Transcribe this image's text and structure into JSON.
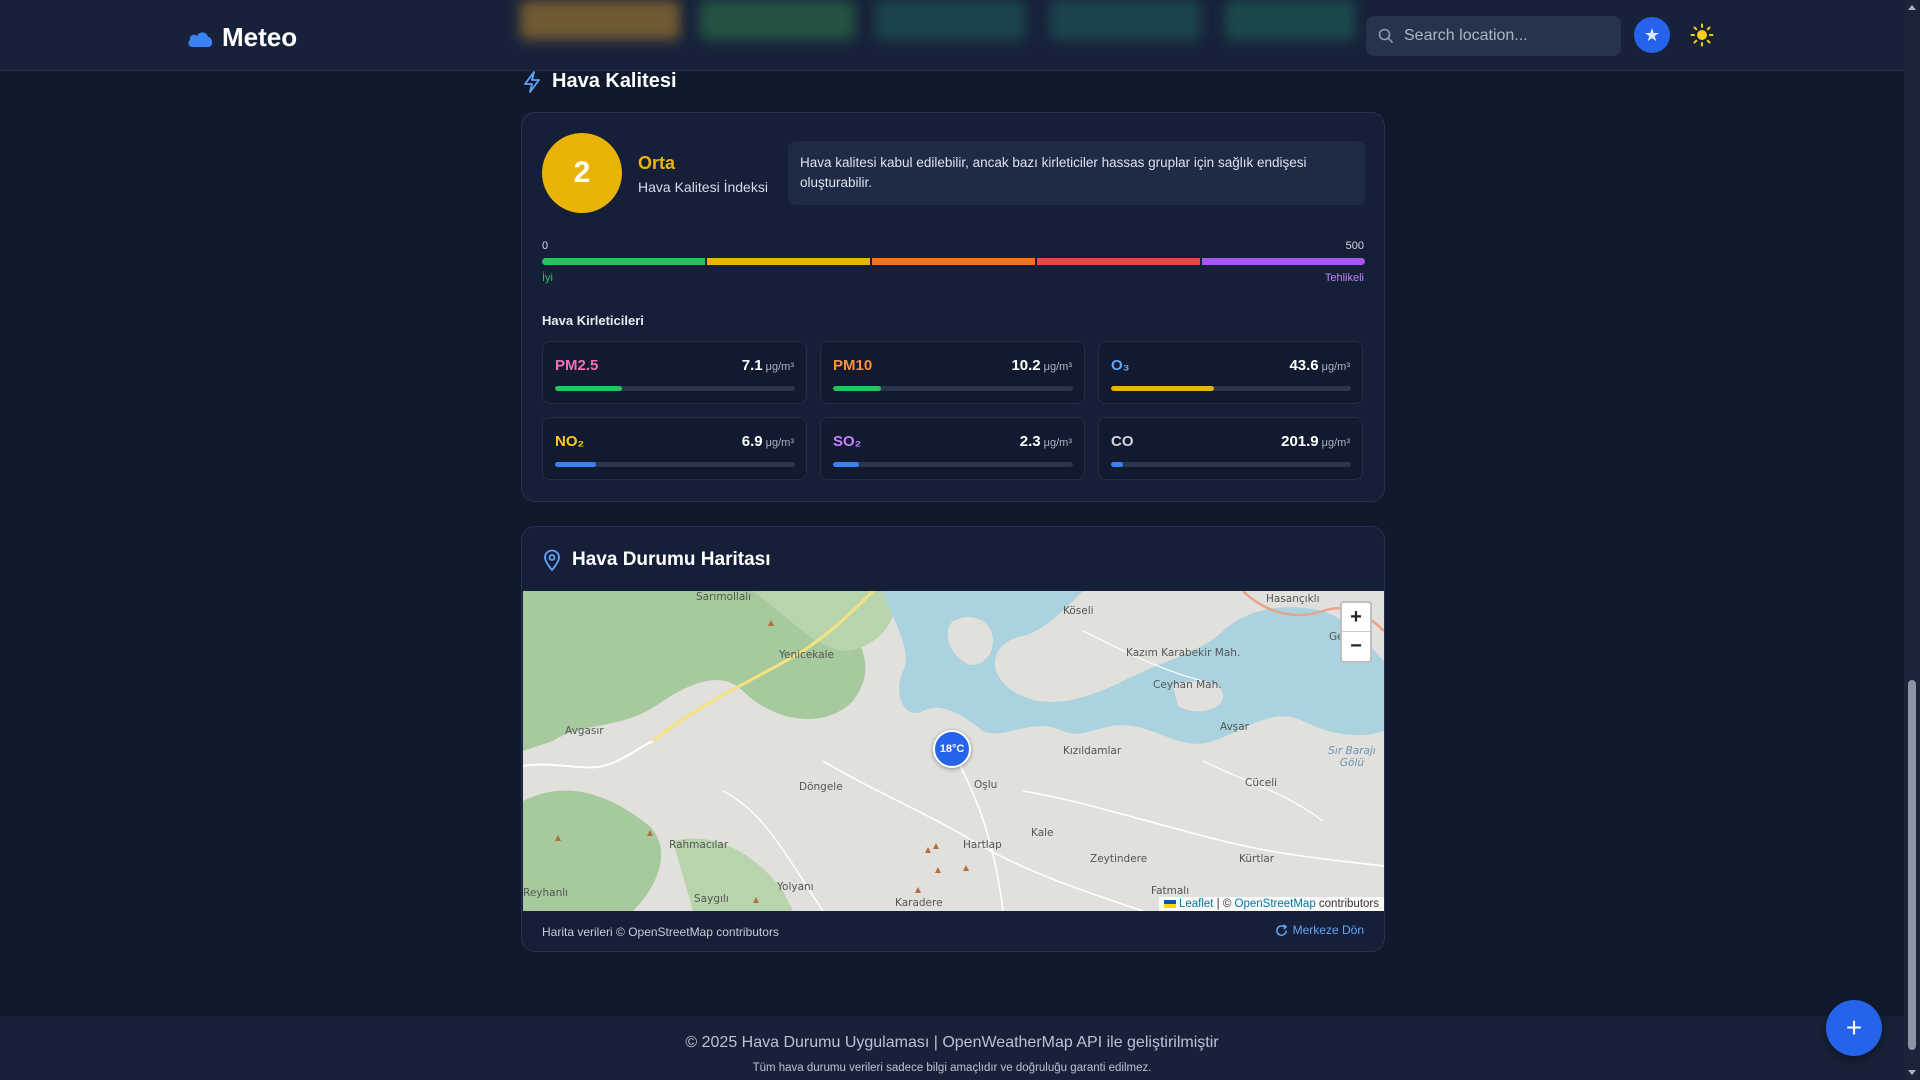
{
  "header": {
    "app_name": "Meteo",
    "search_placeholder": "Search location...",
    "favorites_icon": "star-icon",
    "theme_icon": "sun-icon"
  },
  "air_quality": {
    "section_title": "Hava Kalitesi",
    "aqi_value": "2",
    "aqi_level": "Orta",
    "aqi_label": "Hava Kalitesi İndeksi",
    "description": "Hava kalitesi kabul edilebilir, ancak bazı kirleticiler hassas gruplar için sağlık endişesi oluşturabilir.",
    "scale_min": "0",
    "scale_max": "500",
    "scale_low_label": "İyi",
    "scale_high_label": "Tehlikeli",
    "scale_colors": [
      "#22c55e",
      "#eab308",
      "#f97316",
      "#ef4444",
      "#a855f7"
    ],
    "pollutants_title": "Hava Kirleticileri",
    "pollutants": [
      {
        "name": "PM2.5",
        "value": "7.1",
        "unit": "μg/m³",
        "color": "#f472b6",
        "bar_color": "#22c55e",
        "level_pct": 28
      },
      {
        "name": "PM10",
        "value": "10.2",
        "unit": "μg/m³",
        "color": "#fb923c",
        "bar_color": "#22c55e",
        "level_pct": 20
      },
      {
        "name": "O₃",
        "value": "43.6",
        "unit": "μg/m³",
        "color": "#60a5fa",
        "bar_color": "#eab308",
        "level_pct": 43
      },
      {
        "name": "NO₂",
        "value": "6.9",
        "unit": "μg/m³",
        "color": "#facc15",
        "bar_color": "#3b82f6",
        "level_pct": 17
      },
      {
        "name": "SO₂",
        "value": "2.3",
        "unit": "μg/m³",
        "color": "#c084fc",
        "bar_color": "#3b82f6",
        "level_pct": 11
      },
      {
        "name": "CO",
        "value": "201.9",
        "unit": "μg/m³",
        "color": "#d1d5db",
        "bar_color": "#3b82f6",
        "level_pct": 5
      }
    ]
  },
  "map": {
    "section_title": "Hava Durumu Haritası",
    "marker_temp": "18°C",
    "zoom_in": "+",
    "zoom_out": "−",
    "attribution_leaflet": "Leaflet",
    "attribution_sep": " | © ",
    "attribution_osm": "OpenStreetMap",
    "attribution_tail": " contributors",
    "footer_left": "Harita verileri © OpenStreetMap contributors",
    "center_button": "Merkeze Dön",
    "places": [
      "Sarımollalı",
      "Köseli",
      "Hasançıklı",
      "Yenicekale",
      "Kazım Karabekir Mah.",
      "Ceyhan Mah.",
      "Avgasır",
      "Avşar",
      "Kızıldamlar",
      "Sır Barajı Gölü",
      "Döngele",
      "Oşlu",
      "Cüceli",
      "Rahmacılar",
      "Hartlap",
      "Kale",
      "Zeytindere",
      "Kürtlar",
      "Yolyanı",
      "Saygılı",
      "Karadere",
      "Fatmalı",
      "Reyhanlı",
      "Ge"
    ]
  },
  "footer": {
    "main": "© 2025 Hava Durumu Uygulaması | OpenWeatherMap API ile geliştirilmiştir",
    "sub": "Tüm hava durumu verileri sadece bilgi amaçlıdır ve doğruluğu garanti edilmez."
  },
  "fab_label": "+"
}
